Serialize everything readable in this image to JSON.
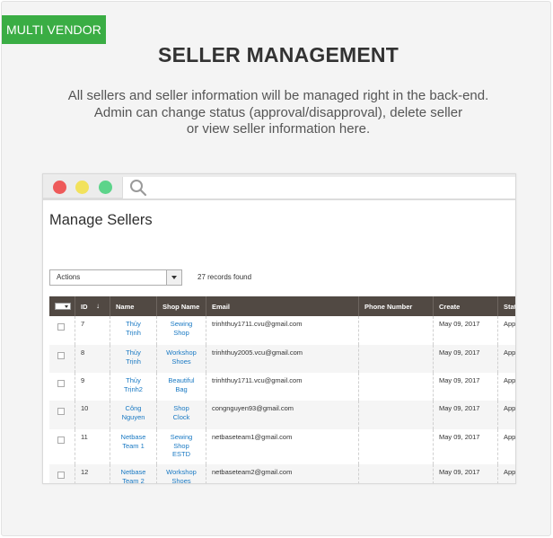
{
  "badge": "MULTI VENDOR",
  "heading": "SELLER MANAGEMENT",
  "description": [
    "All sellers and seller information will be managed right in the back-end.",
    "Admin can change status (approval/disapproval), delete seller",
    "or view seller information here."
  ],
  "window": {
    "search_icon": "search-icon",
    "page_title": "Manage Sellers",
    "actions_label": "Actions",
    "records": "27 records found"
  },
  "table": {
    "headers": [
      "ID",
      "Name",
      "Shop Name",
      "Email",
      "Phone Number",
      "Create",
      "Stat"
    ],
    "sort_indicator": "↓",
    "rows": [
      {
        "id": "7",
        "name": [
          "Thủy",
          "Trịnh"
        ],
        "shop": [
          "Sewing",
          "Shop"
        ],
        "email": "trinhthuy1711.cvu@gmail.com",
        "phone": "",
        "created": "May 09, 2017",
        "status": "App"
      },
      {
        "id": "8",
        "name": [
          "Thủy",
          "Trịnh"
        ],
        "shop": [
          "Workshop",
          "Shoes"
        ],
        "email": "trinhthuy2005.vcu@gmail.com",
        "phone": "",
        "created": "May 09, 2017",
        "status": "App"
      },
      {
        "id": "9",
        "name": [
          "Thủy",
          "Trịnh2"
        ],
        "shop": [
          "Beautiful",
          "Bag"
        ],
        "email": "trinhthuy1711.vcu@gmail.com",
        "phone": "",
        "created": "May 09, 2017",
        "status": "App"
      },
      {
        "id": "10",
        "name": [
          "Công",
          "Nguyen"
        ],
        "shop": [
          "Shop",
          "Clock"
        ],
        "email": "congnguyen93@gmail.com",
        "phone": "",
        "created": "May 09, 2017",
        "status": "App"
      },
      {
        "id": "11",
        "name": [
          "Netbase",
          "Team 1"
        ],
        "shop": [
          "Sewing",
          "Shop",
          "ESTD"
        ],
        "email": "netbaseteam1@gmail.com",
        "phone": "",
        "created": "May 09, 2017",
        "status": "App"
      },
      {
        "id": "12",
        "name": [
          "Netbase",
          "Team 2"
        ],
        "shop": [
          "Workshop",
          "Shoes"
        ],
        "email": "netbaseteam2@gmail.com",
        "phone": "",
        "created": "May 09, 2017",
        "status": "App"
      }
    ]
  },
  "colors": {
    "badge": "#3aad44",
    "table_header": "#514943",
    "link": "#1979c3",
    "dot_red": "#ee5a5a",
    "dot_yellow": "#f2e25c",
    "dot_green": "#5cd48a"
  }
}
